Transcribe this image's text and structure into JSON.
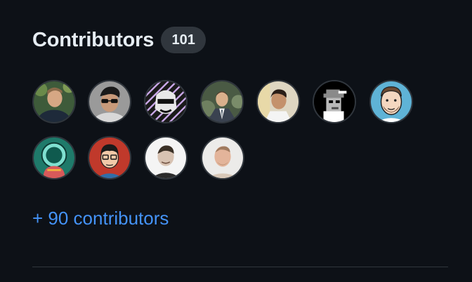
{
  "contributors": {
    "title": "Contributors",
    "count": "101",
    "more_link": "+ 90 contributors",
    "avatars": [
      {
        "icon": "user-avatar-photo",
        "bg": "#3e5b3a"
      },
      {
        "icon": "user-avatar-photo",
        "bg": "#8d8d8d"
      },
      {
        "icon": "user-avatar-illustration",
        "bg": "#1a1a1a"
      },
      {
        "icon": "user-avatar-photo",
        "bg": "#4a5a44"
      },
      {
        "icon": "user-avatar-photo",
        "bg": "#d9d2c0"
      },
      {
        "icon": "user-avatar-pixel-art",
        "bg": "#000000"
      },
      {
        "icon": "user-avatar-cartoon",
        "bg": "#5fb3d6"
      },
      {
        "icon": "user-avatar-astronaut-art",
        "bg": "#1f7a6a"
      },
      {
        "icon": "user-avatar-illustration",
        "bg": "#c0392b"
      },
      {
        "icon": "user-avatar-photo",
        "bg": "#f2f2f2"
      },
      {
        "icon": "user-avatar-photo",
        "bg": "#e8e6e3"
      }
    ]
  },
  "colors": {
    "background": "#0d1117",
    "text": "#e6edf3",
    "badge": "#30363d",
    "link": "#4493f8"
  }
}
